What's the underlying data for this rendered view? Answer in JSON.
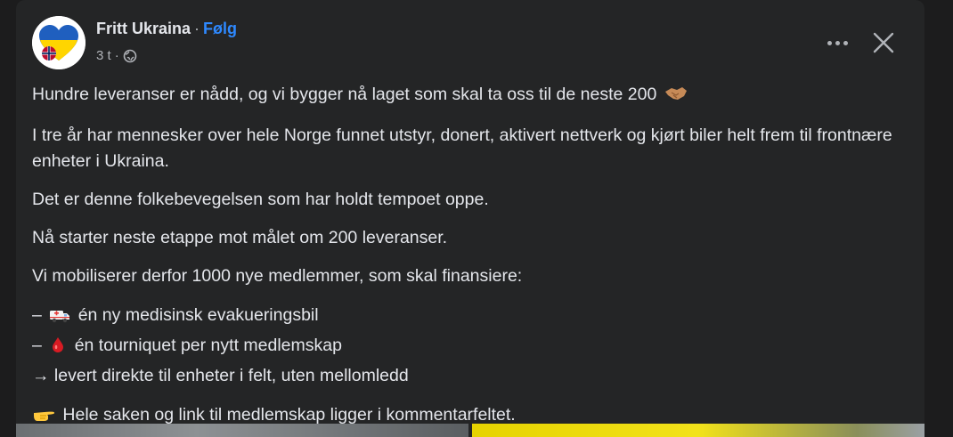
{
  "post": {
    "author": "Fritt Ukraina",
    "separator": "·",
    "follow_label": "Følg",
    "time": "3 t",
    "meta_separator": "·",
    "privacy_icon": "globe-icon",
    "paragraphs": [
      "Hundre leveranser er nådd, og vi bygger nå laget som skal ta oss til de neste 200",
      "I tre år har mennesker over hele Norge funnet utstyr, donert, aktivert nettverk og kjørt biler helt frem til frontnære enheter i Ukraina.",
      "Det er denne folkebevegelsen som har holdt tempoet oppe.",
      "Nå starter neste etappe mot målet om 200 leveranser.",
      "Vi mobiliserer derfor 1000 nye medlemmer, som skal finansiere:"
    ],
    "list": [
      {
        "prefix": "–",
        "text": "én ny medisinsk evakueringsbil",
        "icon": "ambulance-icon"
      },
      {
        "prefix": "–",
        "text": "én tourniquet per nytt medlemskap",
        "icon": "blood-drop-icon"
      },
      {
        "prefix": "→",
        "text": "levert direkte til enheter i felt, uten mellomledd",
        "icon": ""
      }
    ],
    "closing": "Hele saken og link til medlemskap ligger i kommentarfeltet.",
    "closing_icon": "pointing-hand-icon",
    "first_line_icon": "handshake-icon"
  },
  "colors": {
    "background": "#1c1c1d",
    "card": "#242526",
    "text": "#e4e6eb",
    "secondary_text": "#b0b3b8",
    "accent": "#2e89ff"
  }
}
